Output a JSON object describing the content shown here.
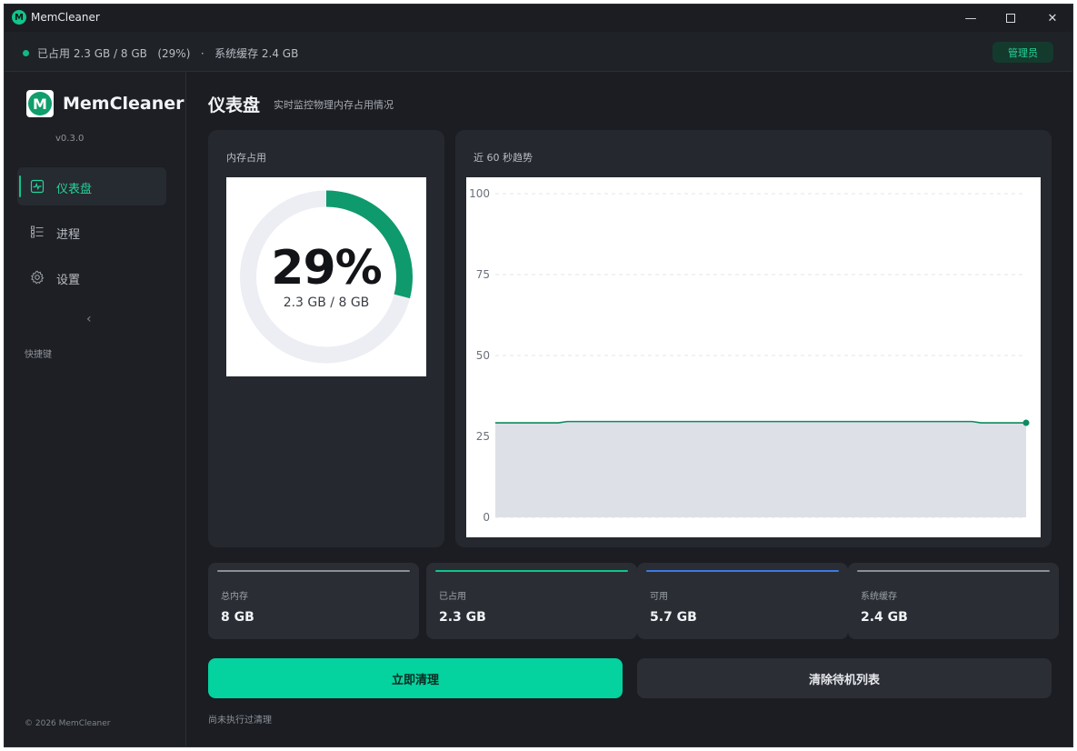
{
  "window": {
    "title": "MemCleaner",
    "controls": {
      "minimize": "—",
      "maximize": "",
      "close": "✕"
    }
  },
  "statusbar": {
    "summary": "已占用 2.3 GB / 8 GB   (29%)   ·   系统缓存 2.4 GB",
    "role_badge": "管理员",
    "dot_color": "#12b886"
  },
  "sidebar": {
    "logo_letter": "M",
    "brand": "MemCleaner",
    "version": "v0.3.0",
    "items": [
      {
        "label": "仪表盘",
        "icon": "activity-icon",
        "active": true
      },
      {
        "label": "进程",
        "icon": "list-icon",
        "active": false
      },
      {
        "label": "设置",
        "icon": "gear-icon",
        "active": false
      }
    ],
    "collapse_glyph": "‹",
    "shortcut_label": "快捷键",
    "copyright": "© 2026 MemCleaner"
  },
  "main": {
    "title": "仪表盘",
    "subtitle": "实时监控物理内存占用情况",
    "usage_card": {
      "title": "内存占用",
      "percent_text": "29%",
      "percent_value": 29,
      "detail": "2.3 GB / 8 GB",
      "ring_color": "#0e9a6c",
      "track_color": "#eceef3"
    },
    "trend_card": {
      "title": "近 60 秒趋势"
    },
    "stats": [
      {
        "label": "总内存",
        "value": "8 GB",
        "color": "#8a8f98"
      },
      {
        "label": "已占用",
        "value": "2.3 GB",
        "color": "#12c48b"
      },
      {
        "label": "可用",
        "value": "5.7 GB",
        "color": "#3b7be0"
      },
      {
        "label": "系统缓存",
        "value": "2.4 GB",
        "color": "#8a8f98"
      }
    ],
    "primary_button": "立即清理",
    "secondary_button": "清除待机列表",
    "last_clean_text": "尚未执行过清理"
  },
  "chart_data": {
    "type": "area",
    "title": "近 60 秒趋势",
    "xlabel": "",
    "ylabel": "",
    "ylim": [
      0,
      100
    ],
    "yticks": [
      0,
      25,
      50,
      75,
      100
    ],
    "grid": true,
    "series": [
      {
        "color": "#0e8a62",
        "fill": "#dde0e7",
        "values": [
          29.2,
          29.2,
          29.2,
          29.2,
          29.2,
          29.2,
          29.2,
          29.2,
          29.6,
          29.6,
          29.6,
          29.6,
          29.6,
          29.6,
          29.6,
          29.6,
          29.6,
          29.6,
          29.6,
          29.6,
          29.6,
          29.6,
          29.6,
          29.6,
          29.6,
          29.6,
          29.6,
          29.6,
          29.6,
          29.6,
          29.6,
          29.6,
          29.6,
          29.6,
          29.6,
          29.6,
          29.6,
          29.6,
          29.6,
          29.6,
          29.6,
          29.6,
          29.6,
          29.6,
          29.6,
          29.6,
          29.6,
          29.6,
          29.6,
          29.6,
          29.6,
          29.6,
          29.6,
          29.6,
          29.2,
          29.2,
          29.2,
          29.2,
          29.2,
          29.2
        ]
      }
    ]
  }
}
